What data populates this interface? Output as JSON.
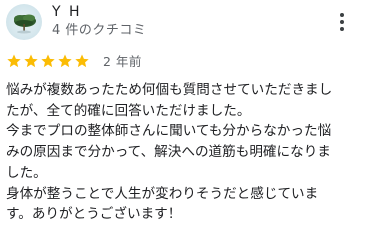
{
  "review": {
    "author_name": "Y H",
    "author_subtitle": "4 件のクチコミ",
    "avatar_icon": "landscape-photo-avatar",
    "rating": 5,
    "rating_max": 5,
    "star_color": "#fbbc04",
    "star_icon": "star-icon",
    "posted_ago": "2 年前",
    "menu_icon": "more-vert-icon",
    "text_lines": [
      "悩みが複数あったため何個も質問させていただきまし",
      "たが、全て的確に回答いただけました。",
      "今までプロの整体師さんに聞いても分からなかった悩",
      "みの原因まで分かって、解決への道筋も明確になりま",
      "した。",
      "身体が整うことで人生が変わりそうだと感じていま",
      "す。ありがとうございます！"
    ]
  }
}
